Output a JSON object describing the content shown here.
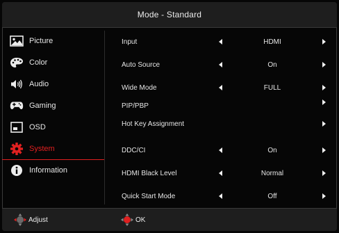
{
  "header": {
    "title": "Mode - Standard"
  },
  "sidebar": {
    "items": [
      {
        "label": "Picture",
        "icon": "picture-icon"
      },
      {
        "label": "Color",
        "icon": "palette-icon"
      },
      {
        "label": "Audio",
        "icon": "speaker-icon"
      },
      {
        "label": "Gaming",
        "icon": "gamepad-icon"
      },
      {
        "label": "OSD",
        "icon": "osd-icon"
      },
      {
        "label": "System",
        "icon": "gear-icon",
        "active": true
      },
      {
        "label": "Information",
        "icon": "info-icon"
      }
    ]
  },
  "settings": {
    "input": {
      "label": "Input",
      "value": "HDMI"
    },
    "auto_source": {
      "label": "Auto Source",
      "value": "On"
    },
    "wide_mode": {
      "label": "Wide Mode",
      "value": "FULL"
    },
    "pip": {
      "label": "PIP/PBP"
    },
    "hot_key": {
      "label": "Hot Key Assignment"
    },
    "ddc_ci": {
      "label": "DDC/CI",
      "value": "On"
    },
    "hdmi_black": {
      "label": "HDMI Black Level",
      "value": "Normal"
    },
    "quick_start": {
      "label": "Quick Start Mode",
      "value": "Off"
    }
  },
  "footer": {
    "adjust": "Adjust",
    "ok": "OK"
  },
  "colors": {
    "accent": "#e02020",
    "background": "#060606",
    "panel": "#1e1e1e",
    "text": "#ececec"
  }
}
